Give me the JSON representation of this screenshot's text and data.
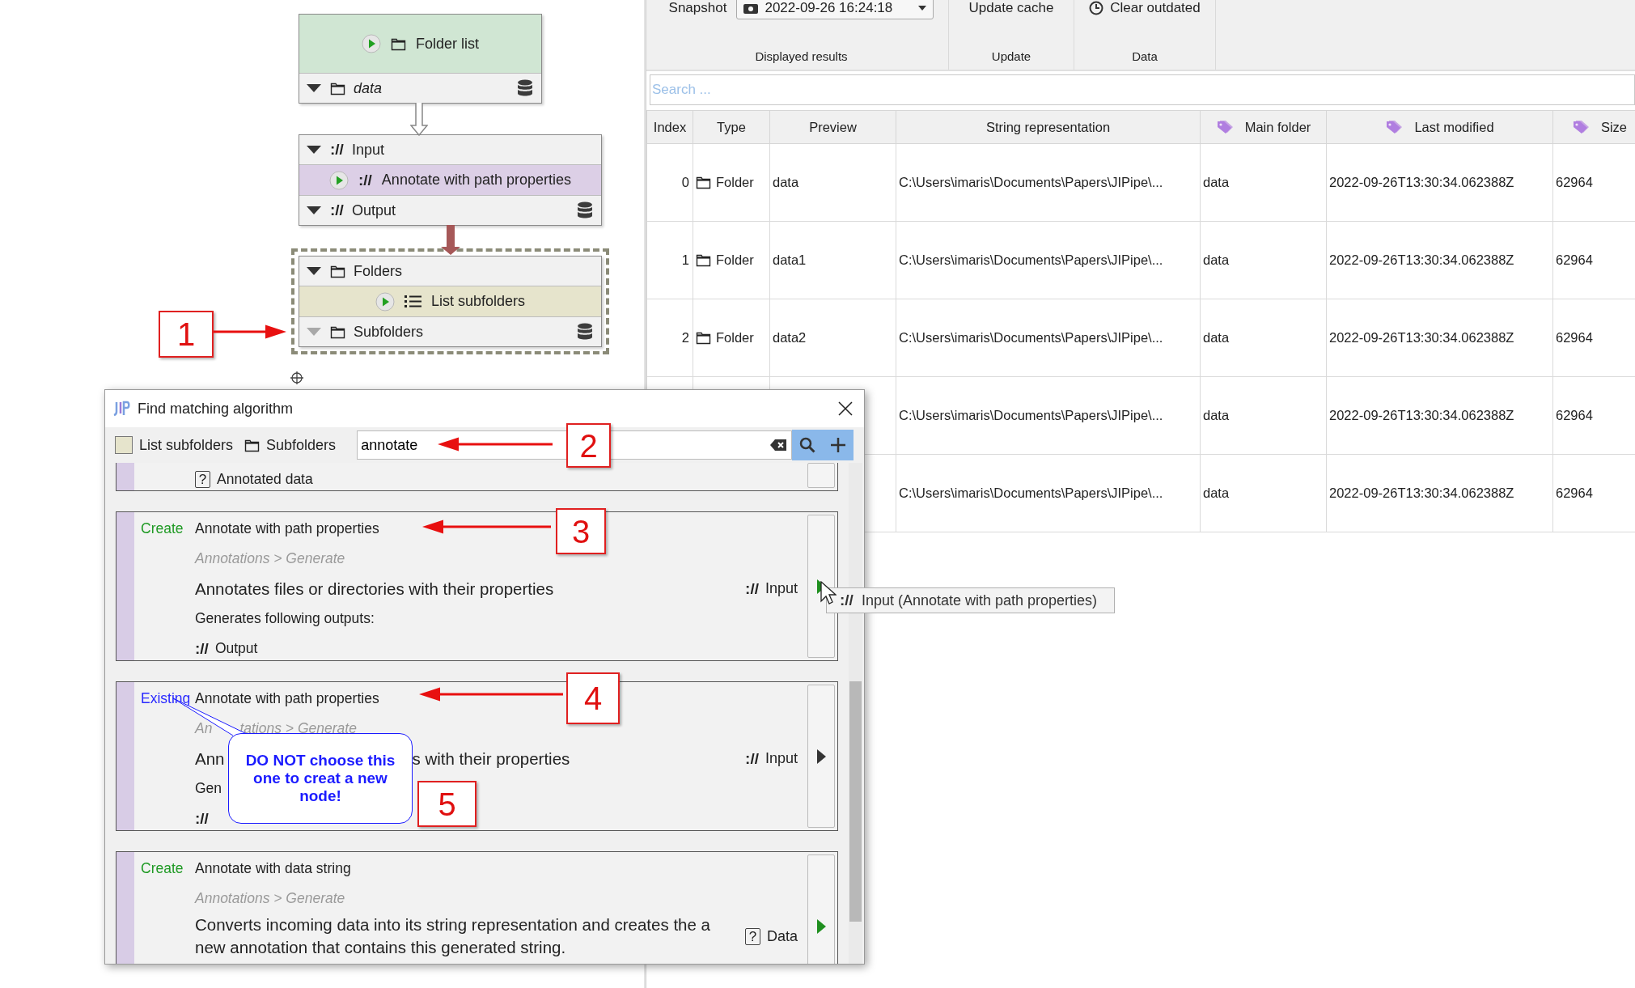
{
  "graph": {
    "nodes": [
      {
        "title": "Folder list",
        "kind": "folder",
        "color": "#d0e6d3",
        "selected": false,
        "outputs": [
          {
            "label": "data",
            "kind": "folder",
            "italic": true,
            "enabled": true,
            "cached": true
          }
        ]
      },
      {
        "title": "Annotate with path properties",
        "kind": "annotation",
        "glyph": "://",
        "color": "#dccfe6",
        "selected": false,
        "inputs": [
          {
            "label": "Input",
            "kind": "annotation",
            "glyph": "://",
            "italic": false,
            "enabled": true,
            "cached": false
          }
        ],
        "outputs": [
          {
            "label": "Output",
            "kind": "annotation",
            "glyph": "://",
            "italic": false,
            "enabled": true,
            "cached": true
          }
        ]
      },
      {
        "title": "List subfolders",
        "kind": "list",
        "color": "#e6e4cc",
        "selected": true,
        "inputs": [
          {
            "label": "Folders",
            "kind": "folder",
            "italic": false,
            "enabled": true,
            "cached": false
          }
        ],
        "outputs": [
          {
            "label": "Subfolders",
            "kind": "folder",
            "italic": false,
            "enabled": false,
            "cached": true
          }
        ]
      }
    ]
  },
  "ribbon": {
    "groups": [
      {
        "kind": "snapshot",
        "label": "Displayed results",
        "caption": "Snapshot",
        "value": "2022-09-26 16:24:18"
      },
      {
        "kind": "button",
        "label": "Update",
        "button": "Update cache"
      },
      {
        "kind": "clock-button",
        "label": "Data",
        "button": "Clear outdated"
      }
    ]
  },
  "search": {
    "placeholder": "Search ..."
  },
  "table": {
    "columns": [
      {
        "label": "Index",
        "tagged": false
      },
      {
        "label": "Type",
        "tagged": false
      },
      {
        "label": "Preview",
        "tagged": false
      },
      {
        "label": "String representation",
        "tagged": false
      },
      {
        "label": "Main folder",
        "tagged": true
      },
      {
        "label": "Last modified",
        "tagged": true
      },
      {
        "label": "Size",
        "tagged": true
      }
    ],
    "rows": [
      {
        "index": "0",
        "type": "Folder",
        "preview": "data",
        "string": "C:\\Users\\imaris\\Documents\\Papers\\JIPipe\\...",
        "main_folder": "data",
        "last_modified": "2022-09-26T13:30:34.062388Z",
        "size": "62964"
      },
      {
        "index": "1",
        "type": "Folder",
        "preview": "data1",
        "string": "C:\\Users\\imaris\\Documents\\Papers\\JIPipe\\...",
        "main_folder": "data",
        "last_modified": "2022-09-26T13:30:34.062388Z",
        "size": "62964"
      },
      {
        "index": "2",
        "type": "Folder",
        "preview": "data2",
        "string": "C:\\Users\\imaris\\Documents\\Papers\\JIPipe\\...",
        "main_folder": "data",
        "last_modified": "2022-09-26T13:30:34.062388Z",
        "size": "62964"
      },
      {
        "string": "C:\\Users\\imaris\\Documents\\Papers\\JIPipe\\...",
        "main_folder": "data",
        "last_modified": "2022-09-26T13:30:34.062388Z",
        "size": "62964"
      },
      {
        "string": "C:\\Users\\imaris\\Documents\\Papers\\JIPipe\\...",
        "main_folder": "data",
        "last_modified": "2022-09-26T13:30:34.062388Z",
        "size": "62964"
      }
    ]
  },
  "dialog": {
    "title": "Find matching algorithm",
    "source": {
      "node": "List subfolders",
      "color": "#e6e4cc",
      "slot": "Subfolders"
    },
    "search": {
      "value": "annotate"
    },
    "cards": [
      {
        "kind": "partial",
        "outputs": [
          {
            "kind": "unknown",
            "glyph": "?",
            "label": "Annotated data"
          }
        ]
      },
      {
        "kind": "create",
        "status": "Create",
        "title": "Annotate with path properties",
        "category": [
          "Annotations > Generate"
        ],
        "description": [
          "Annotates files or directories with their properties"
        ],
        "input": {
          "kind": "annotation",
          "glyph": "://",
          "label": "Input"
        },
        "outputs_label": "Generates following outputs:",
        "outputs": [
          {
            "kind": "annotation",
            "glyph": "://",
            "label": "Output"
          }
        ]
      },
      {
        "kind": "existing",
        "status": "Existing",
        "title": "Annotate with path properties",
        "category": [
          "An",
          "tations > Generate"
        ],
        "description": [
          "Ann",
          "s with their properties"
        ],
        "input": {
          "kind": "annotation",
          "glyph": "://",
          "label": "Input"
        },
        "outputs_label": "Gen",
        "outputs": [
          {
            "kind": "annotation",
            "glyph": "://"
          }
        ]
      },
      {
        "kind": "create",
        "status": "Create",
        "title": "Annotate with data string",
        "category": [
          "Annotations > Generate"
        ],
        "description": [
          "Converts incoming data into its string representation and creates the a new annotation that contains this generated string."
        ],
        "input": {
          "kind": "unknown",
          "glyph": "?",
          "label": "Data"
        }
      }
    ],
    "tooltip": {
      "glyph": "://",
      "text": "Input (Annotate with path properties)"
    }
  },
  "annotations": {
    "markers": [
      "1",
      "2",
      "3",
      "4",
      "5"
    ],
    "callout": "DO NOT choose this one to creat a new node!"
  }
}
